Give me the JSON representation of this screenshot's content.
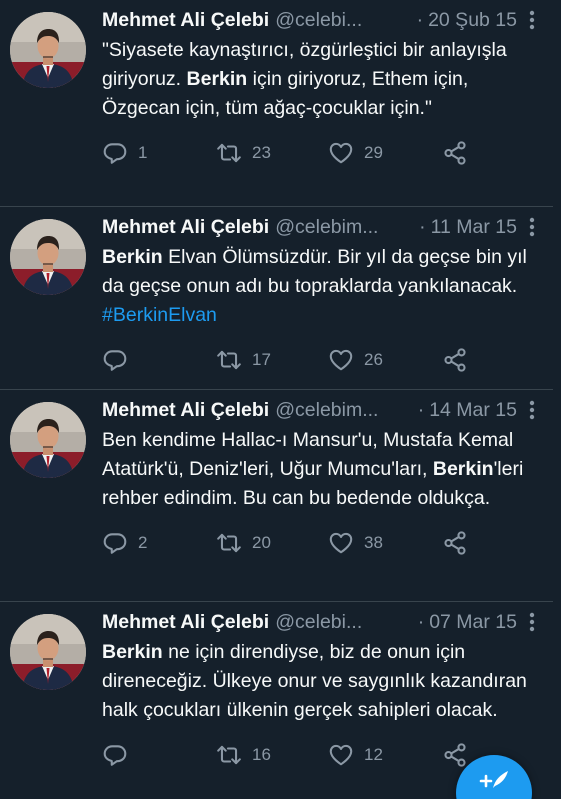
{
  "tweets": [
    {
      "author": "Mehmet Ali Çelebi",
      "handle": "@celebi...",
      "date": "20 Şub 15",
      "text_parts": [
        {
          "t": "\"Siyasete kaynaştırıcı, özgürleştici bir anlayışla giriyoruz. ",
          "s": "normal"
        },
        {
          "t": "Berkin",
          "s": "bold"
        },
        {
          "t": " için giriyoruz, Ethem için, Özgecan için, tüm ağaç-çocuklar için.\"",
          "s": "normal"
        }
      ],
      "replies": "1",
      "retweets": "23",
      "likes": "29"
    },
    {
      "author": "Mehmet Ali Çelebi",
      "handle": "@celebim...",
      "date": "11 Mar 15",
      "text_parts": [
        {
          "t": "Berkin",
          "s": "bold"
        },
        {
          "t": " Elvan Ölümsüzdür. Bir yıl da geçse bin yıl da geçse onun adı bu topraklarda yankılanacak. ",
          "s": "normal"
        },
        {
          "t": "#BerkinElvan",
          "s": "hashtag"
        }
      ],
      "replies": "",
      "retweets": "17",
      "likes": "26"
    },
    {
      "author": "Mehmet Ali Çelebi",
      "handle": "@celebim...",
      "date": "14 Mar 15",
      "text_parts": [
        {
          "t": "Ben kendime Hallac-ı Mansur'u, Mustafa Kemal Atatürk'ü, Deniz'leri, Uğur Mumcu'ları, ",
          "s": "normal"
        },
        {
          "t": "Berkin",
          "s": "bold"
        },
        {
          "t": "'leri rehber edindim. Bu can bu bedende oldukça.",
          "s": "normal"
        }
      ],
      "replies": "2",
      "retweets": "20",
      "likes": "38"
    },
    {
      "author": "Mehmet Ali Çelebi",
      "handle": "@celebi...",
      "date": "07 Mar 15",
      "text_parts": [
        {
          "t": "Berkin",
          "s": "bold"
        },
        {
          "t": " ne için direndiyse, biz de onun için direneceğiz. Ülkeye onur ve saygınlık kazandıran halk çocukları ülkenin gerçek sahipleri olacak.",
          "s": "normal"
        }
      ],
      "replies": "",
      "retweets": "16",
      "likes": "12"
    }
  ],
  "colors": {
    "background": "#15202b",
    "text": "#f7f9f9",
    "muted": "#8b98a5",
    "accent": "#1d9bf0",
    "divider": "#38444d"
  },
  "icons": {
    "reply": "reply-icon",
    "retweet": "retweet-icon",
    "like": "like-icon",
    "share": "share-icon",
    "more": "more-icon",
    "compose": "compose-tweet-icon"
  }
}
